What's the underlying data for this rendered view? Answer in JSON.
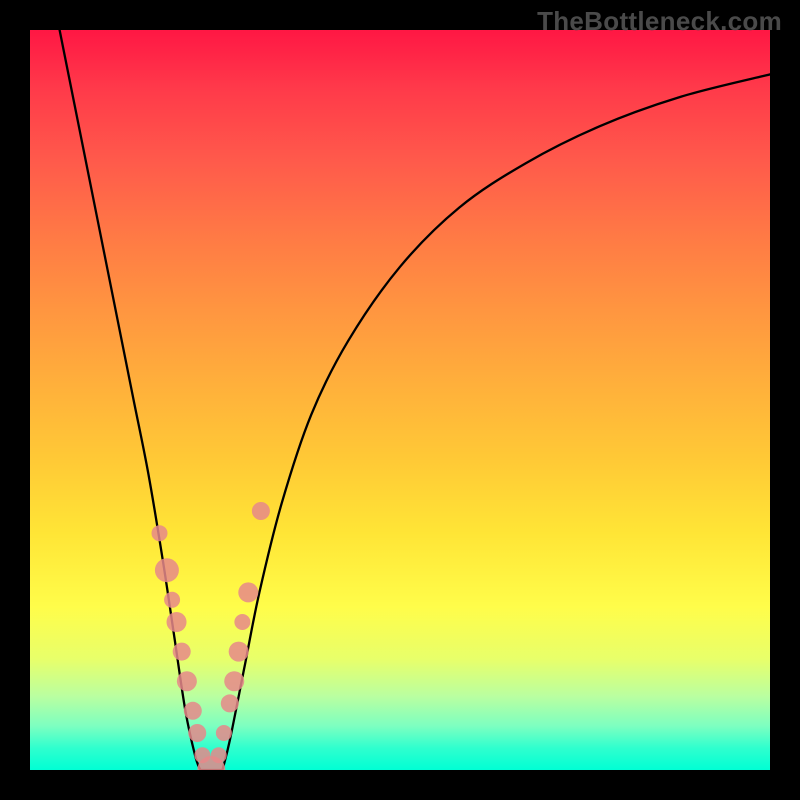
{
  "watermark": "TheBottleneck.com",
  "chart_data": {
    "type": "line",
    "title": "",
    "xlabel": "",
    "ylabel": "",
    "xlim": [
      0,
      100
    ],
    "ylim": [
      0,
      100
    ],
    "grid": false,
    "legend": false,
    "annotations": [],
    "background_gradient": {
      "top": "#ff1744",
      "middle": "#ffe536",
      "bottom": "#00ffd4"
    },
    "series": [
      {
        "name": "left-curve",
        "color": "#000000",
        "x": [
          4,
          6,
          8,
          10,
          12,
          14,
          16,
          18,
          19.5,
          21,
          22.3,
          23
        ],
        "y": [
          100,
          90,
          80,
          70,
          60,
          50,
          40,
          28,
          18,
          8,
          2,
          0
        ]
      },
      {
        "name": "right-curve",
        "color": "#000000",
        "x": [
          26,
          27,
          29,
          31,
          34,
          38,
          43,
          50,
          58,
          67,
          77,
          88,
          100
        ],
        "y": [
          0,
          4,
          14,
          24,
          36,
          48,
          58,
          68,
          76,
          82,
          87,
          91,
          94
        ]
      },
      {
        "name": "bottleneck-floor",
        "color": "#000000",
        "x": [
          23,
          24.5,
          26
        ],
        "y": [
          0,
          0,
          0
        ]
      }
    ],
    "scatter": {
      "name": "sample-points",
      "color": "#e6888a",
      "x": [
        17.5,
        18.5,
        19.2,
        19.8,
        20.5,
        21.2,
        22.0,
        22.6,
        23.3,
        24.5,
        25.5,
        26.2,
        27.0,
        27.6,
        28.2,
        28.7,
        29.5,
        31.2
      ],
      "y": [
        32,
        27,
        23,
        20,
        16,
        12,
        8,
        5,
        2,
        0,
        2,
        5,
        9,
        12,
        16,
        20,
        24,
        35
      ],
      "radius": [
        8,
        12,
        8,
        10,
        9,
        10,
        9,
        9,
        8,
        14,
        8,
        8,
        9,
        10,
        10,
        8,
        10,
        9
      ]
    }
  }
}
